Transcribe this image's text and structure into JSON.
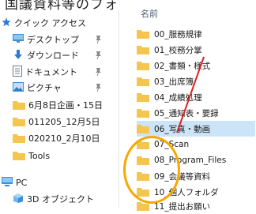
{
  "top_fragment": "国議資料等のフォ",
  "nav": {
    "items": [
      {
        "label": "クイック アクセス",
        "icon": "star-icon",
        "pinned": false
      },
      {
        "label": "デスクトップ",
        "icon": "desktop-folder-icon",
        "pinned": true
      },
      {
        "label": "ダウンロード",
        "icon": "download-arrow-icon",
        "pinned": true
      },
      {
        "label": "ドキュメント",
        "icon": "documents-icon",
        "pinned": true
      },
      {
        "label": "ピクチャ",
        "icon": "pictures-icon",
        "pinned": true
      },
      {
        "label": "6月8日企画・15日",
        "icon": "folder-icon",
        "pinned": false
      },
      {
        "label": "011205_12月5日",
        "icon": "folder-icon",
        "pinned": false
      },
      {
        "label": "020210_2月10日",
        "icon": "folder-icon",
        "pinned": false
      },
      {
        "label": "Tools",
        "icon": "folder-icon",
        "pinned": false
      },
      {
        "label": "PC",
        "icon": "pc-icon",
        "pinned": false
      },
      {
        "label": "3D オブジェクト",
        "icon": "3d-objects-icon",
        "pinned": false
      }
    ]
  },
  "content": {
    "column_header": "名前",
    "files": [
      {
        "name": "00_服務規律"
      },
      {
        "name": "01_校務分掌"
      },
      {
        "name": "02_書類・様式"
      },
      {
        "name": "03_出席簿"
      },
      {
        "name": "04_成績処理"
      },
      {
        "name": "05_通知表・要録"
      },
      {
        "name": "06_写真・動画"
      },
      {
        "name": "07_Scan"
      },
      {
        "name": "08_Program_Files"
      },
      {
        "name": "09_会議等資料"
      },
      {
        "name": "10_個人フォルダ"
      },
      {
        "name": "11_提出お願い"
      }
    ],
    "selected_index": 6
  },
  "colors": {
    "folder": "#f5c64f",
    "selection": "#cce4f7",
    "highlight_circle": "#f6a800",
    "arrow": "#e02020"
  }
}
